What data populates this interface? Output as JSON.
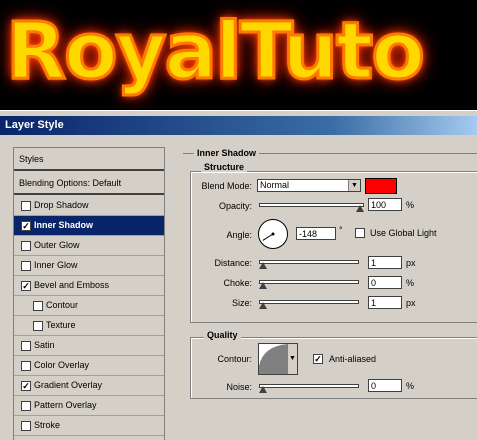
{
  "banner": {
    "text": "RoyalTuto",
    "colors": {
      "fill": "#ffd800",
      "glow": "#ff3c00"
    }
  },
  "dialog": {
    "title": "Layer Style",
    "styles_list": [
      {
        "label": "Styles",
        "checkbox": false,
        "checked": false,
        "selected": false,
        "indent": false,
        "header": true
      },
      {
        "label": "Blending Options: Default",
        "checkbox": false,
        "checked": false,
        "selected": false,
        "indent": false,
        "header": true
      },
      {
        "label": "Drop Shadow",
        "checkbox": true,
        "checked": false,
        "selected": false,
        "indent": false
      },
      {
        "label": "Inner Shadow",
        "checkbox": true,
        "checked": true,
        "selected": true,
        "indent": false
      },
      {
        "label": "Outer Glow",
        "checkbox": true,
        "checked": false,
        "selected": false,
        "indent": false
      },
      {
        "label": "Inner Glow",
        "checkbox": true,
        "checked": false,
        "selected": false,
        "indent": false
      },
      {
        "label": "Bevel and Emboss",
        "checkbox": true,
        "checked": true,
        "selected": false,
        "indent": false
      },
      {
        "label": "Contour",
        "checkbox": true,
        "checked": false,
        "selected": false,
        "indent": true
      },
      {
        "label": "Texture",
        "checkbox": true,
        "checked": false,
        "selected": false,
        "indent": true
      },
      {
        "label": "Satin",
        "checkbox": true,
        "checked": false,
        "selected": false,
        "indent": false
      },
      {
        "label": "Color Overlay",
        "checkbox": true,
        "checked": false,
        "selected": false,
        "indent": false
      },
      {
        "label": "Gradient Overlay",
        "checkbox": true,
        "checked": true,
        "selected": false,
        "indent": false
      },
      {
        "label": "Pattern Overlay",
        "checkbox": true,
        "checked": false,
        "selected": false,
        "indent": false
      },
      {
        "label": "Stroke",
        "checkbox": true,
        "checked": false,
        "selected": false,
        "indent": false
      }
    ],
    "inner_shadow": {
      "title": "Inner Shadow",
      "structure": {
        "title": "Structure",
        "blend_mode_label": "Blend Mode:",
        "blend_mode_value": "Normal",
        "shadow_color": "#ff0000",
        "opacity_label": "Opacity:",
        "opacity_value": "100",
        "opacity_unit": "%",
        "opacity_level": 1.0,
        "angle_label": "Angle:",
        "angle_value": "-148",
        "angle_unit": "°",
        "global_light_label": "Use Global Light",
        "global_light_checked": false,
        "distance_label": "Distance:",
        "distance_value": "1",
        "distance_unit": "px",
        "distance_level": 0.0,
        "choke_label": "Choke:",
        "choke_value": "0",
        "choke_unit": "%",
        "choke_level": 0.0,
        "size_label": "Size:",
        "size_value": "1",
        "size_unit": "px",
        "size_level": 0.0
      },
      "quality": {
        "title": "Quality",
        "contour_label": "Contour:",
        "anti_aliased_label": "Anti-aliased",
        "anti_aliased_checked": true,
        "noise_label": "Noise:",
        "noise_value": "0",
        "noise_unit": "%",
        "noise_level": 0.0
      }
    }
  }
}
